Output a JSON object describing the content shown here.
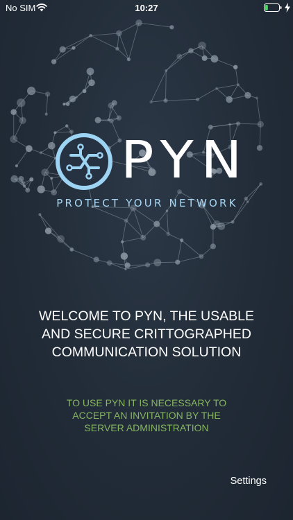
{
  "status_bar": {
    "carrier": "No SIM",
    "time": "10:27",
    "battery_level": 0.2,
    "charging": true,
    "wifi_icon": "wifi-icon",
    "battery_icon": "battery-icon",
    "charging_icon": "bolt-icon"
  },
  "logo": {
    "mark_icon": "pyn-logo-icon",
    "wordmark": "PYN",
    "tagline": "PROTECT YOUR NETWORK"
  },
  "welcome": {
    "text": "WELCOME TO PYN, THE USABLE\nAND SECURE CRITTOGRAPHED\nCOMMUNICATION SOLUTION"
  },
  "instruction": {
    "text": "TO USE PYN IT IS NECESSARY TO\nACCEPT AN INVITATION BY THE\nSERVER ADMINISTRATION"
  },
  "settings": {
    "label": "Settings"
  },
  "colors": {
    "background": "#222c38",
    "tagline": "#a7d6f2",
    "logo_ring": "#9dd3f3",
    "instruction": "#86b560",
    "text": "#ffffff",
    "network": "#8b97a3"
  }
}
